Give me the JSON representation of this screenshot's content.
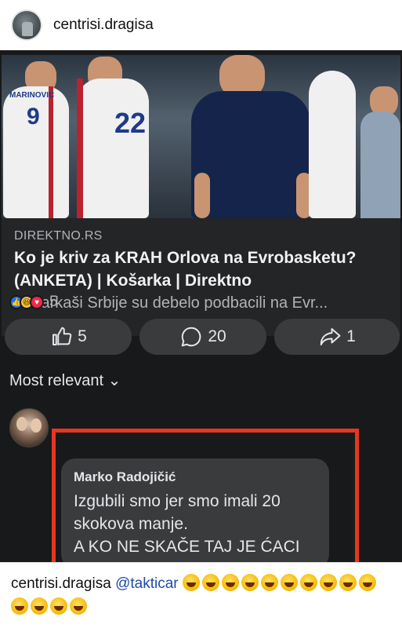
{
  "post_header": {
    "username": "centrisi.dragisa"
  },
  "link_preview": {
    "domain": "DIREKTNO.RS",
    "title_line1": "Ko je kriv za KRAH Orlova na Evrobasketu?",
    "title_line2": "(ANKETA) | Košarka | Direktno",
    "description": "Košarkaši Srbije su debelo podbacili na Evr...",
    "photo": {
      "jersey_name": "MARINOVIC",
      "jersey_number_left": "9",
      "jersey_number_right": "22"
    }
  },
  "reactions": {
    "icons": [
      "like-icon",
      "haha-icon",
      "love-icon"
    ],
    "count": "5"
  },
  "actions": {
    "like_count": "5",
    "comment_count": "20",
    "share_count": "1"
  },
  "sort": {
    "label": "Most relevant ⌄"
  },
  "comment": {
    "author": "Marko Radojičić",
    "lines": [
      "Izgubili smo jer smo imali 20",
      "skokova manje.",
      "A KO NE SKAČE TAJ JE ĆACI"
    ]
  },
  "caption": {
    "username": "centrisi.dragisa",
    "mention": "@takticar",
    "emoji_name": "rolling-on-the-floor-laughing",
    "emoji_count": 14
  },
  "colors": {
    "dark_bg": "#18191a",
    "card_bg": "#242526",
    "pill_bg": "#3a3b3c",
    "highlight_red": "#e8361f",
    "mention_blue": "#1e4aa8"
  }
}
